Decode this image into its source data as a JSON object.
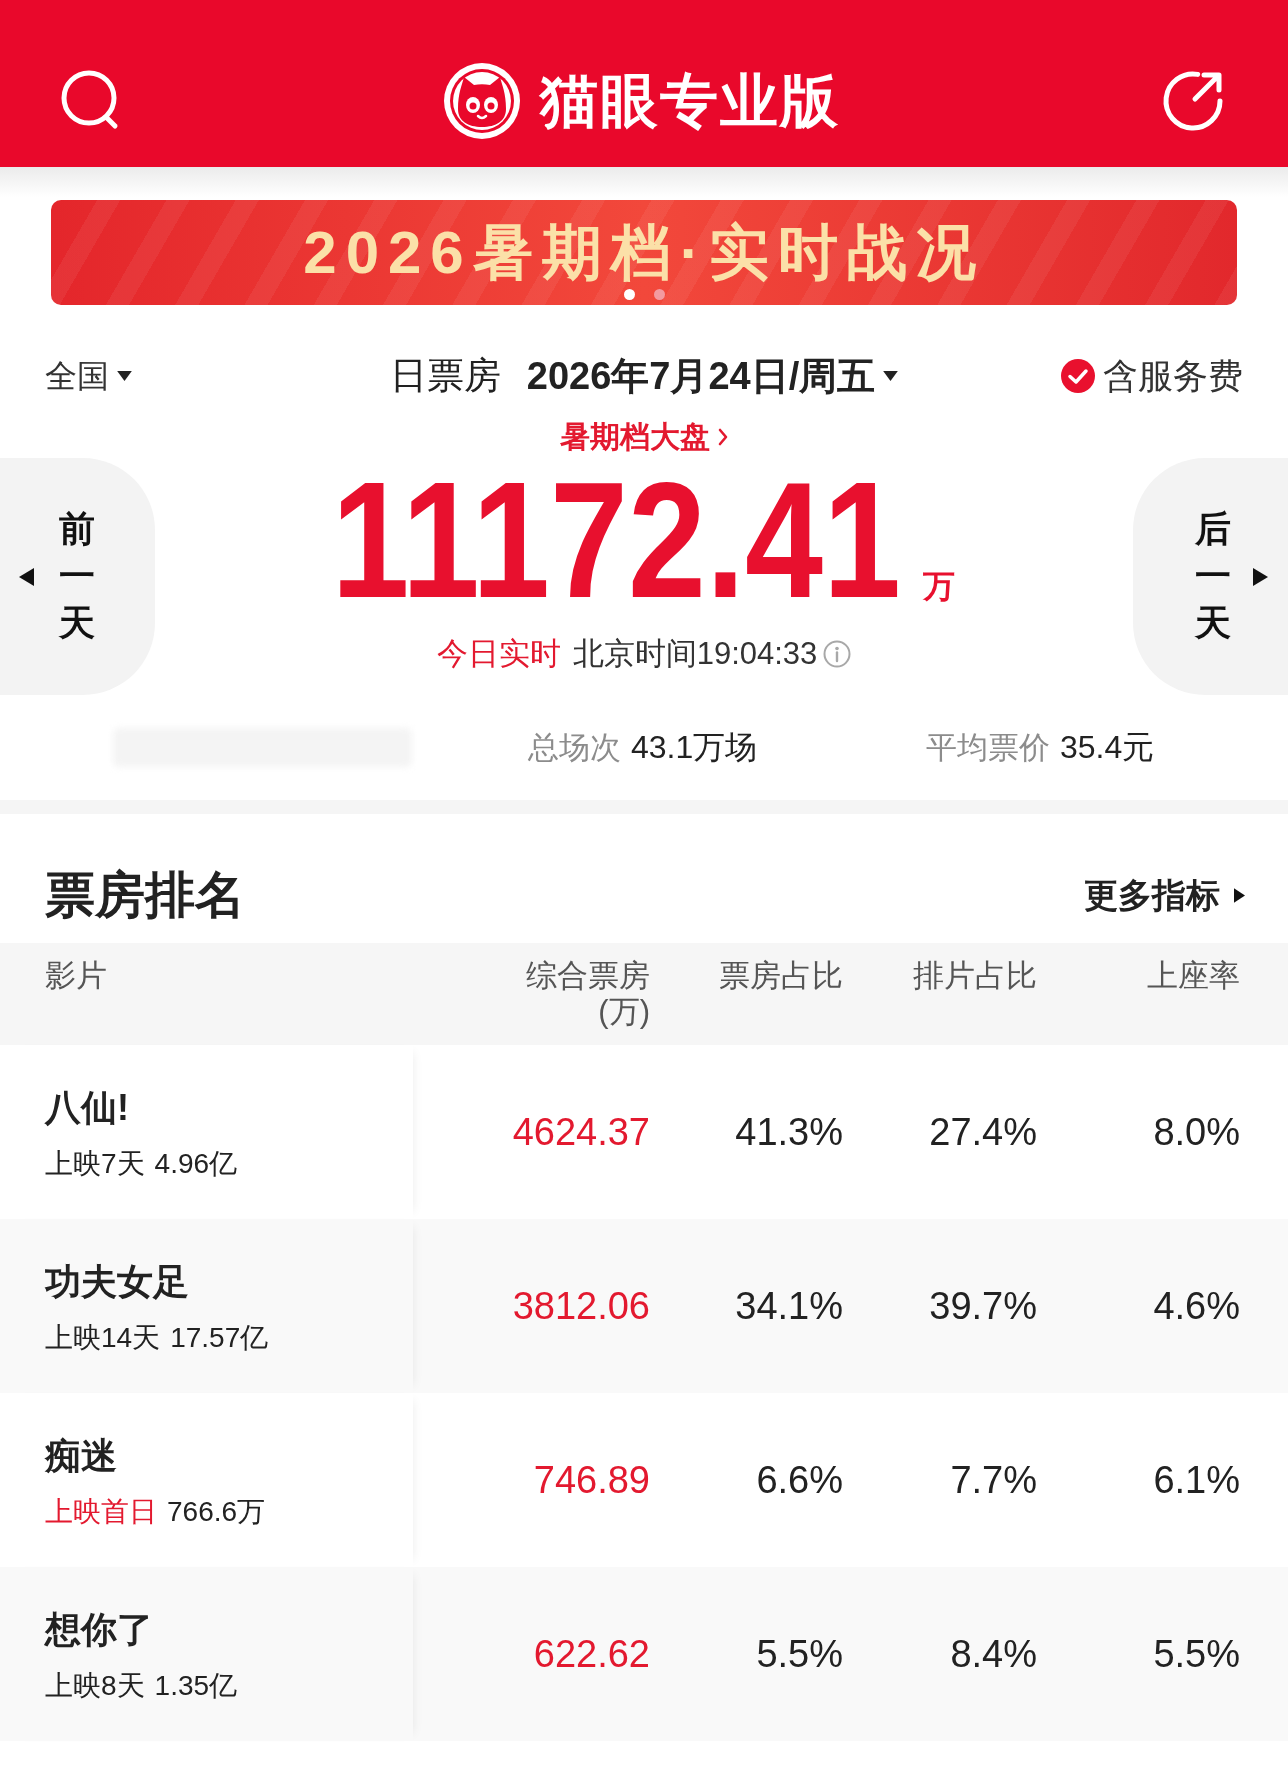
{
  "header": {
    "title": "猫眼专业版"
  },
  "banner": {
    "text": "2026暑期档·实时战况",
    "dots": [
      {
        "selected": true
      },
      {
        "selected": false
      }
    ]
  },
  "summary": {
    "region": "全国",
    "label": "日票房",
    "date": "2026年7月24日/周五",
    "service_fee": {
      "label": "含服务费",
      "checked": true
    },
    "season_link": "暑期档大盘",
    "total": "11172.41",
    "unit": "万",
    "prev_day": "前一天",
    "next_day": "后一天",
    "realtime": "今日实时",
    "time": "北京时间19:04:33"
  },
  "stats": [
    {
      "label": "总场次",
      "value": "43.1万场"
    },
    {
      "label": "平均票价",
      "value": "35.4元"
    }
  ],
  "ranking": {
    "title": "票房排名",
    "more": "更多指标",
    "columns": [
      "影片",
      "综合票房(万)",
      "票房占比",
      "排片占比",
      "上座率"
    ],
    "rows": [
      {
        "title": "八仙!",
        "release": "上映7天",
        "total": "4.96亿",
        "first_day": false,
        "box_office": "4624.37",
        "box_office_share": "41.3%",
        "screening_share": "27.4%",
        "occupancy": "8.0%"
      },
      {
        "title": "功夫女足",
        "release": "上映14天",
        "total": "17.57亿",
        "first_day": false,
        "box_office": "3812.06",
        "box_office_share": "34.1%",
        "screening_share": "39.7%",
        "occupancy": "4.6%"
      },
      {
        "title": "痴迷",
        "release": "上映首日",
        "total": "766.6万",
        "first_day": true,
        "box_office": "746.89",
        "box_office_share": "6.6%",
        "screening_share": "7.7%",
        "occupancy": "6.1%"
      },
      {
        "title": "想你了",
        "release": "上映8天",
        "total": "1.35亿",
        "first_day": false,
        "box_office": "622.62",
        "box_office_share": "5.5%",
        "screening_share": "8.4%",
        "occupancy": "5.5%"
      }
    ]
  }
}
